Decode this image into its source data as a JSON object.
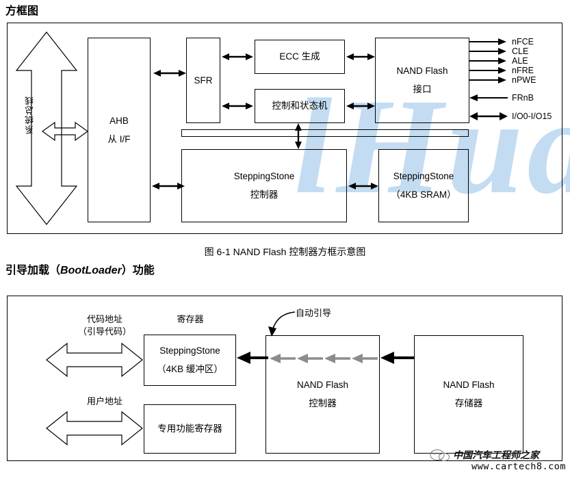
{
  "sections": {
    "block_diagram_title": "方框图",
    "bootloader_title_pre": "引导加载（",
    "bootloader_title_em": "BootLoader",
    "bootloader_title_post": "）功能"
  },
  "figure1": {
    "caption": "图 6-1 NAND Flash 控制器方框示意图",
    "bus_label": "系统总线",
    "blocks": {
      "ahb": {
        "line1": "AHB",
        "line2": "从 I/F"
      },
      "sfr": {
        "line1": "SFR"
      },
      "ecc": {
        "line1": "ECC 生成"
      },
      "ctrl_state": {
        "line1": "控制和状态机"
      },
      "nand_if": {
        "line1": "NAND Flash",
        "line2": "接口"
      },
      "ss_ctrl": {
        "line1": "SteppingStone",
        "line2": "控制器"
      },
      "ss_sram": {
        "line1": "SteppingStone",
        "line2": "（4KB SRAM）"
      }
    },
    "signals": [
      {
        "name": "nFCE",
        "direction": "out"
      },
      {
        "name": "CLE",
        "direction": "out"
      },
      {
        "name": "ALE",
        "direction": "out"
      },
      {
        "name": "nFRE",
        "direction": "out"
      },
      {
        "name": "nPWE",
        "direction": "out"
      },
      {
        "name": "FRnB",
        "direction": "in"
      },
      {
        "name": "I/O0-I/O15",
        "direction": "bi"
      }
    ]
  },
  "figure2": {
    "labels": {
      "code_addr_l1": "代码地址",
      "code_addr_l2": "（引导代码）",
      "user_addr": "用户地址",
      "register": "寄存器",
      "auto_boot": "自动引导"
    },
    "blocks": {
      "steppingstone": {
        "line1": "SteppingStone",
        "line2": "（4KB 缓冲区）"
      },
      "sfr_block": {
        "line1": "专用功能寄存器"
      },
      "nand_ctrl": {
        "line1": "NAND Flash",
        "line2": "控制器"
      },
      "nand_mem": {
        "line1": "NAND Flash",
        "line2": "存储器"
      }
    }
  },
  "watermark": {
    "text": "lHuaan",
    "color": "#c3dcf2"
  },
  "footer": {
    "brand_cn": "中国汽车工程师之家",
    "site": "www.cartech8.com"
  }
}
